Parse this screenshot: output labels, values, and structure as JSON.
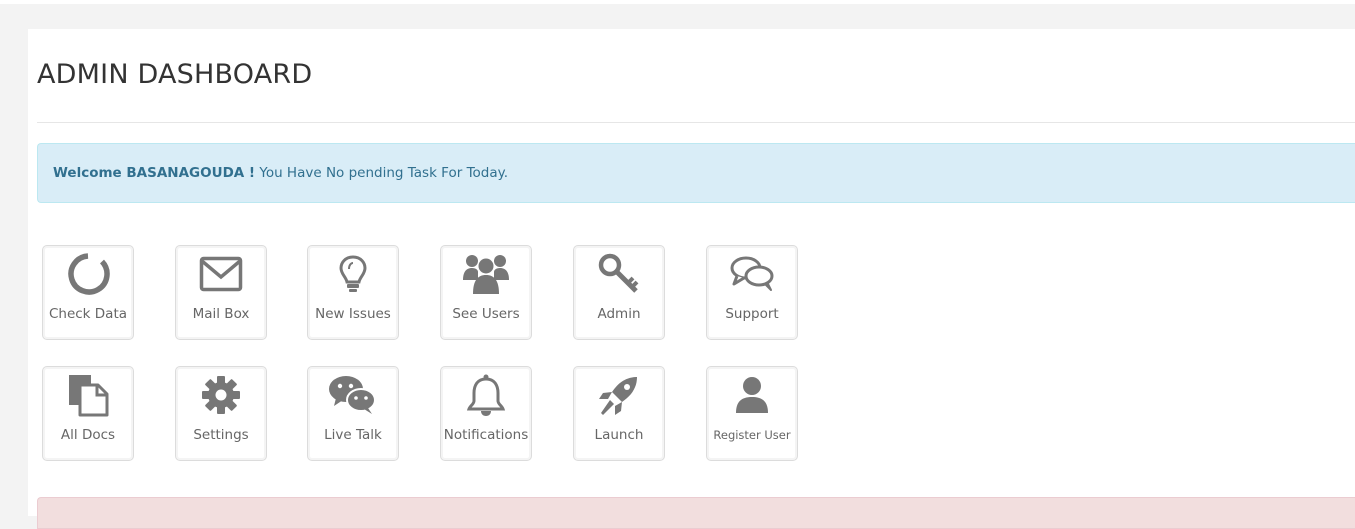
{
  "page": {
    "title": "ADMIN DASHBOARD"
  },
  "alert": {
    "name": "Welcome BASANAGOUDA !",
    "message": " You Have No pending Task For Today."
  },
  "tiles_row1": [
    {
      "label": "Check Data",
      "icon": "circle-notch-icon"
    },
    {
      "label": "Mail Box",
      "icon": "envelope-icon"
    },
    {
      "label": "New Issues",
      "icon": "lightbulb-icon"
    },
    {
      "label": "See Users",
      "icon": "users-icon"
    },
    {
      "label": "Admin",
      "icon": "key-icon"
    },
    {
      "label": "Support",
      "icon": "chat-bubbles-icon"
    }
  ],
  "tiles_row2": [
    {
      "label": "All Docs",
      "icon": "documents-icon"
    },
    {
      "label": "Settings",
      "icon": "gear-icon"
    },
    {
      "label": "Live Talk",
      "icon": "wechat-icon"
    },
    {
      "label": "Notifications",
      "icon": "bell-icon"
    },
    {
      "label": "Launch",
      "icon": "rocket-icon"
    },
    {
      "label": "Register User",
      "icon": "user-icon"
    }
  ],
  "colors": {
    "icon": "#777777",
    "alert_info_bg": "#d9edf7",
    "alert_info_text": "#31708f",
    "alert_danger_bg": "#f2dede"
  }
}
